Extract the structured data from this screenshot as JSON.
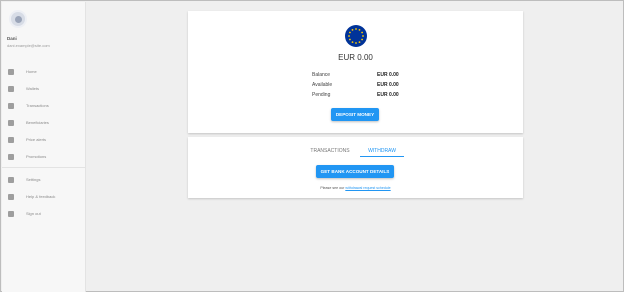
{
  "sidebar": {
    "user": {
      "name": "Dani",
      "email": "dani.example@site.com"
    },
    "items": [
      {
        "label": "Home",
        "icon": "home-icon"
      },
      {
        "label": "Wallets",
        "icon": "wallet-icon"
      },
      {
        "label": "Transactions",
        "icon": "transactions-icon"
      },
      {
        "label": "Beneficiaries",
        "icon": "beneficiaries-icon"
      },
      {
        "label": "Price alerts",
        "icon": "price-alerts-icon"
      },
      {
        "label": "Promotions",
        "icon": "promotions-icon"
      }
    ],
    "secondary": [
      {
        "label": "Settings",
        "icon": "settings-icon"
      },
      {
        "label": "Help & feedback",
        "icon": "help-icon"
      },
      {
        "label": "Sign out",
        "icon": "sign-out-icon"
      }
    ]
  },
  "wallet": {
    "currency_flag": "eu-flag-icon",
    "balance_title": "EUR 0.00",
    "rows": [
      {
        "label": "Balance",
        "value": "EUR 0.00"
      },
      {
        "label": "Available",
        "value": "EUR 0.00"
      },
      {
        "label": "Pending",
        "value": "EUR 0.00"
      }
    ],
    "deposit_label": "DEPOSIT MONEY"
  },
  "tabs": {
    "transactions": "TRANSACTIONS",
    "withdraw": "WITHDRAW",
    "active": "withdraw"
  },
  "withdraw": {
    "bank_button": "GET BANK ACCOUNT DETAILS",
    "note_prefix": "Please see our",
    "note_link": "withdrawal request schedule"
  },
  "colors": {
    "accent": "#2196f3",
    "flag_blue": "#003399",
    "flag_star": "#ffcc00"
  }
}
